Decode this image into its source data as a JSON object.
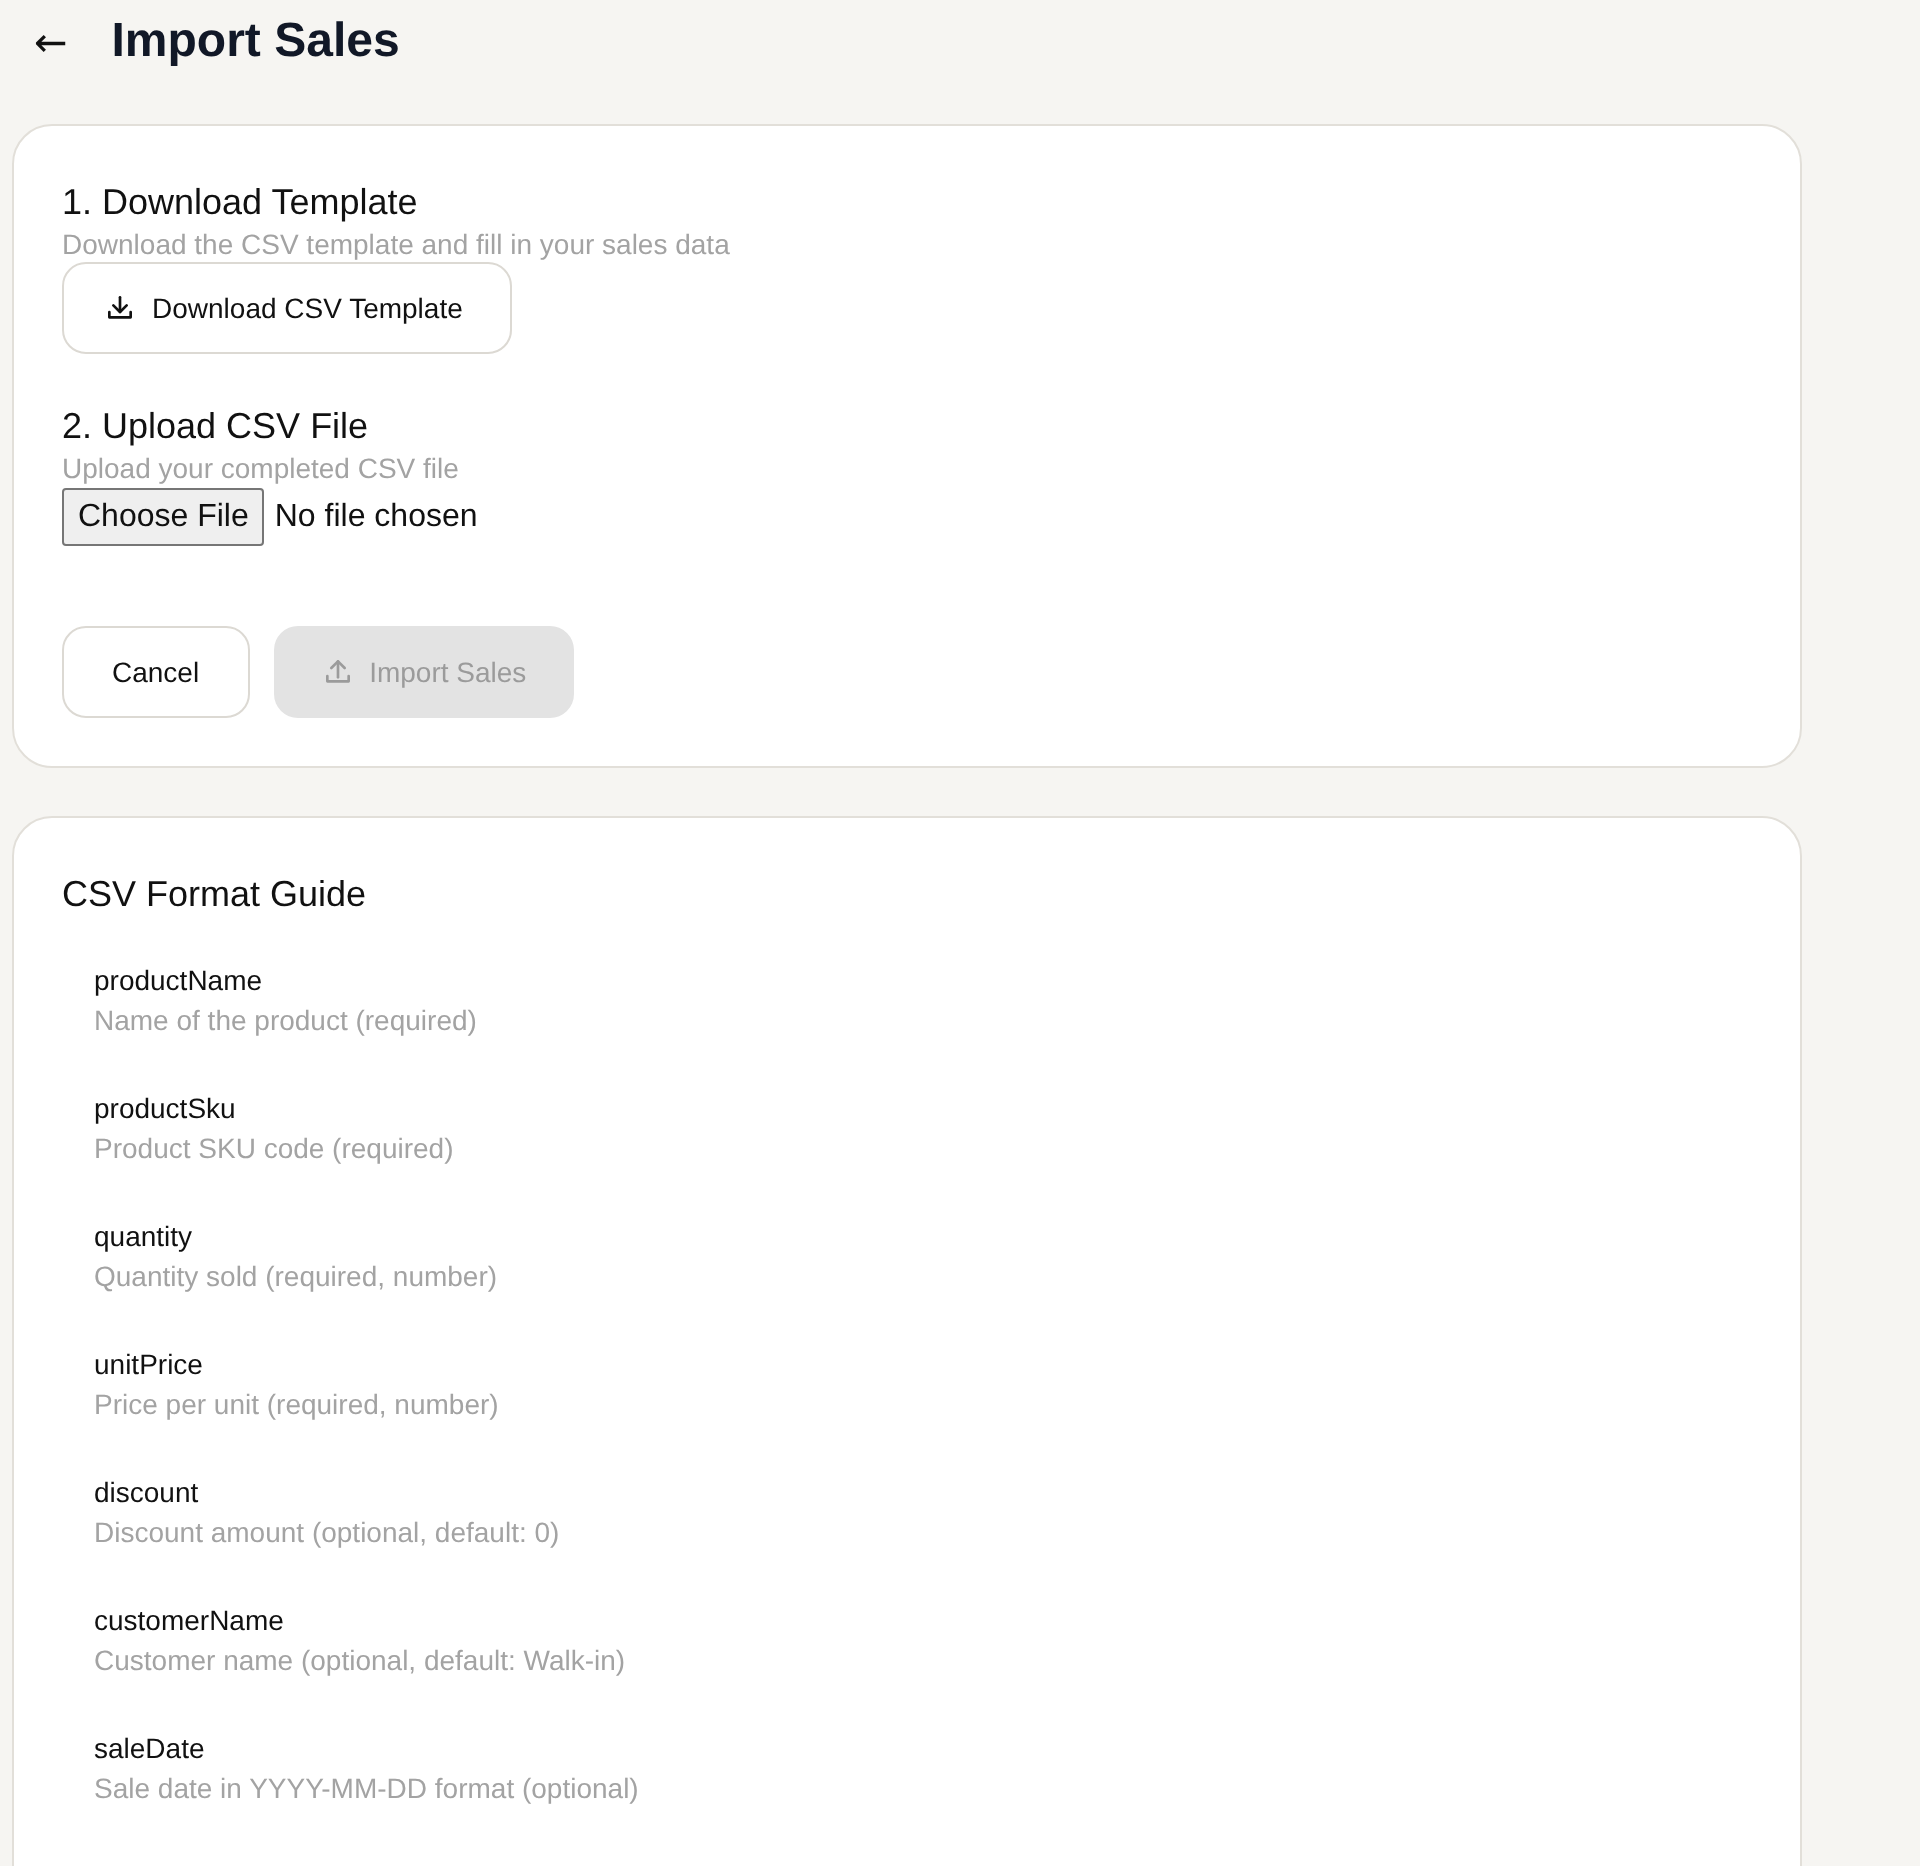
{
  "header": {
    "back_icon": "←",
    "title": "Import Sales"
  },
  "import_card": {
    "steps": [
      {
        "kind": "download",
        "title": "1. Download Template",
        "description": "Download the CSV template and fill in your sales data",
        "button": "Download CSV Template"
      },
      {
        "kind": "upload",
        "title": "2. Upload CSV File",
        "description": "Upload your completed CSV file",
        "choose_button": "Choose File",
        "file_status": "No file chosen"
      }
    ],
    "actions": [
      {
        "label": "Cancel",
        "kind": "cancel",
        "disabled": false
      },
      {
        "label": "Import Sales",
        "kind": "import",
        "disabled": true
      }
    ]
  },
  "guide": {
    "title": "CSV Format Guide",
    "fields": [
      {
        "name": "productName",
        "description": "Name of the product (required)"
      },
      {
        "name": "productSku",
        "description": "Product SKU code (required)"
      },
      {
        "name": "quantity",
        "description": "Quantity sold (required, number)"
      },
      {
        "name": "unitPrice",
        "description": "Price per unit (required, number)"
      },
      {
        "name": "discount",
        "description": "Discount amount (optional, default: 0)"
      },
      {
        "name": "customerName",
        "description": "Customer name (optional, default: Walk-in)"
      },
      {
        "name": "saleDate",
        "description": "Sale date in YYYY-MM-DD format (optional)"
      }
    ]
  }
}
